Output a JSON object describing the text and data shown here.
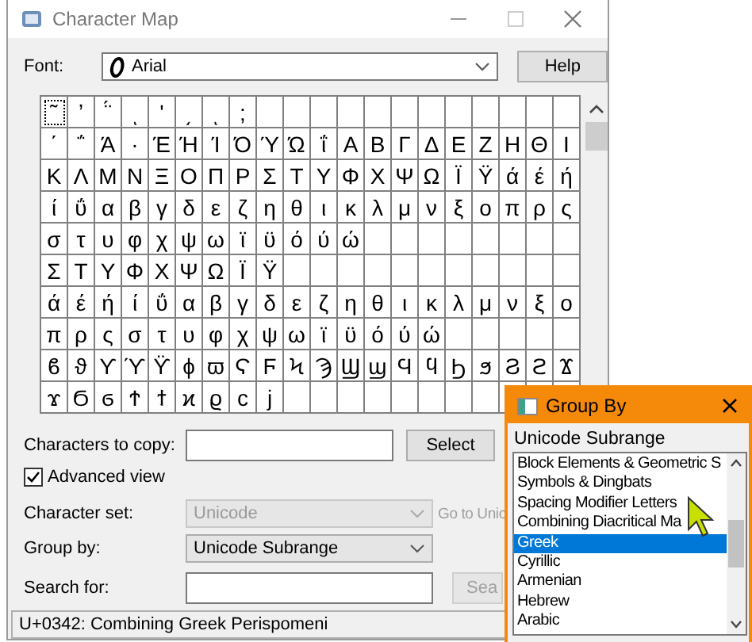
{
  "window": {
    "title": "Character Map"
  },
  "font": {
    "label": "Font:",
    "value": "Arial",
    "button": "Help"
  },
  "grid": {
    "rows": [
      [
        {
          "char": "˜",
          "selected": true
        },
        {
          "char": "̓",
          "selected": false
        },
        {
          "char": "̈́",
          "selected": false
        },
        {
          "char": "ͅ",
          "selected": false
        },
        {
          "char": "ʹ",
          "selected": false
        },
        {
          "char": "͵",
          "selected": false
        },
        {
          "char": "ͺ",
          "selected": false
        },
        {
          "char": ";",
          "selected": false
        }
      ],
      [
        {
          "char": "΄",
          "selected": false
        },
        {
          "char": "΅",
          "selected": false
        },
        {
          "char": "Ά",
          "selected": false
        },
        {
          "char": "·",
          "selected": false
        },
        {
          "char": "Έ",
          "selected": false
        },
        {
          "char": "Ή",
          "selected": false
        },
        {
          "char": "Ί",
          "selected": false
        },
        {
          "char": "Ό",
          "selected": false
        },
        {
          "char": "Ύ",
          "selected": false
        },
        {
          "char": "Ώ",
          "selected": false
        },
        {
          "char": "ΐ",
          "selected": false
        },
        {
          "char": "Α",
          "selected": false
        },
        {
          "char": "Β",
          "selected": false
        },
        {
          "char": "Γ",
          "selected": false
        },
        {
          "char": "Δ",
          "selected": false
        },
        {
          "char": "Ε",
          "selected": false
        },
        {
          "char": "Ζ",
          "selected": false
        },
        {
          "char": "Η",
          "selected": false
        },
        {
          "char": "Θ",
          "selected": false
        },
        {
          "char": "Ι",
          "selected": false
        }
      ],
      [
        {
          "char": "Κ",
          "selected": false
        },
        {
          "char": "Λ",
          "selected": false
        },
        {
          "char": "Μ",
          "selected": false
        },
        {
          "char": "Ν",
          "selected": false
        },
        {
          "char": "Ξ",
          "selected": false
        },
        {
          "char": "Ο",
          "selected": false
        },
        {
          "char": "Π",
          "selected": false
        },
        {
          "char": "Ρ",
          "selected": false
        },
        {
          "char": "Σ",
          "selected": false
        },
        {
          "char": "Τ",
          "selected": false
        },
        {
          "char": "Υ",
          "selected": false
        },
        {
          "char": "Φ",
          "selected": false
        },
        {
          "char": "Χ",
          "selected": false
        },
        {
          "char": "Ψ",
          "selected": false
        },
        {
          "char": "Ω",
          "selected": false
        },
        {
          "char": "Ϊ",
          "selected": false
        },
        {
          "char": "Ϋ",
          "selected": false
        },
        {
          "char": "ά",
          "selected": false
        },
        {
          "char": "έ",
          "selected": false
        },
        {
          "char": "ή",
          "selected": false
        }
      ],
      [
        {
          "char": "ί",
          "selected": false
        },
        {
          "char": "ΰ",
          "selected": false
        },
        {
          "char": "α",
          "selected": false
        },
        {
          "char": "β",
          "selected": false
        },
        {
          "char": "γ",
          "selected": false
        },
        {
          "char": "δ",
          "selected": false
        },
        {
          "char": "ε",
          "selected": false
        },
        {
          "char": "ζ",
          "selected": false
        },
        {
          "char": "η",
          "selected": false
        },
        {
          "char": "θ",
          "selected": false
        },
        {
          "char": "ι",
          "selected": false
        },
        {
          "char": "κ",
          "selected": false
        },
        {
          "char": "λ",
          "selected": false
        },
        {
          "char": "μ",
          "selected": false
        },
        {
          "char": "ν",
          "selected": false
        },
        {
          "char": "ξ",
          "selected": false
        },
        {
          "char": "ο",
          "selected": false
        },
        {
          "char": "π",
          "selected": false
        },
        {
          "char": "ρ",
          "selected": false
        },
        {
          "char": "ς",
          "selected": false
        }
      ],
      [
        {
          "char": "σ",
          "selected": false
        },
        {
          "char": "τ",
          "selected": false
        },
        {
          "char": "υ",
          "selected": false
        },
        {
          "char": "φ",
          "selected": false
        },
        {
          "char": "χ",
          "selected": false
        },
        {
          "char": "ψ",
          "selected": false
        },
        {
          "char": "ω",
          "selected": false
        },
        {
          "char": "ϊ",
          "selected": false
        },
        {
          "char": "ϋ",
          "selected": false
        },
        {
          "char": "ό",
          "selected": false
        },
        {
          "char": "ύ",
          "selected": false
        },
        {
          "char": "ώ",
          "selected": false
        }
      ],
      [
        {
          "char": "Σ",
          "selected": false
        },
        {
          "char": "Τ",
          "selected": false
        },
        {
          "char": "Υ",
          "selected": false
        },
        {
          "char": "Φ",
          "selected": false
        },
        {
          "char": "Χ",
          "selected": false
        },
        {
          "char": "Ψ",
          "selected": false
        },
        {
          "char": "Ω",
          "selected": false
        },
        {
          "char": "Ϊ",
          "selected": false
        },
        {
          "char": "Ϋ",
          "selected": false
        }
      ],
      [
        {
          "char": "ά",
          "selected": false
        },
        {
          "char": "έ",
          "selected": false
        },
        {
          "char": "ή",
          "selected": false
        },
        {
          "char": "ί",
          "selected": false
        },
        {
          "char": "ΰ",
          "selected": false
        },
        {
          "char": "α",
          "selected": false
        },
        {
          "char": "β",
          "selected": false
        },
        {
          "char": "γ",
          "selected": false
        },
        {
          "char": "δ",
          "selected": false
        },
        {
          "char": "ε",
          "selected": false
        },
        {
          "char": "ζ",
          "selected": false
        },
        {
          "char": "η",
          "selected": false
        },
        {
          "char": "θ",
          "selected": false
        },
        {
          "char": "ι",
          "selected": false
        },
        {
          "char": "κ",
          "selected": false
        },
        {
          "char": "λ",
          "selected": false
        },
        {
          "char": "μ",
          "selected": false
        },
        {
          "char": "ν",
          "selected": false
        },
        {
          "char": "ξ",
          "selected": false
        },
        {
          "char": "ο",
          "selected": false
        }
      ],
      [
        {
          "char": "π",
          "selected": false
        },
        {
          "char": "ρ",
          "selected": false
        },
        {
          "char": "ς",
          "selected": false
        },
        {
          "char": "σ",
          "selected": false
        },
        {
          "char": "τ",
          "selected": false
        },
        {
          "char": "υ",
          "selected": false
        },
        {
          "char": "φ",
          "selected": false
        },
        {
          "char": "χ",
          "selected": false
        },
        {
          "char": "ψ",
          "selected": false
        },
        {
          "char": "ω",
          "selected": false
        },
        {
          "char": "ϊ",
          "selected": false
        },
        {
          "char": "ϋ",
          "selected": false
        },
        {
          "char": "ό",
          "selected": false
        },
        {
          "char": "ύ",
          "selected": false
        },
        {
          "char": "ώ",
          "selected": false
        }
      ],
      [
        {
          "char": "ϐ",
          "selected": false
        },
        {
          "char": "ϑ",
          "selected": false
        },
        {
          "char": "ϒ",
          "selected": false
        },
        {
          "char": "ϓ",
          "selected": false
        },
        {
          "char": "ϔ",
          "selected": false
        },
        {
          "char": "ϕ",
          "selected": false
        },
        {
          "char": "ϖ",
          "selected": false
        },
        {
          "char": "Ϛ",
          "selected": false
        },
        {
          "char": "Ϝ",
          "selected": false
        },
        {
          "char": "Ϟ",
          "selected": false
        },
        {
          "char": "Ϡ",
          "selected": false
        },
        {
          "char": "Ϣ",
          "selected": false
        },
        {
          "char": "ϣ",
          "selected": false
        },
        {
          "char": "Ϥ",
          "selected": false
        },
        {
          "char": "ϥ",
          "selected": false
        },
        {
          "char": "Ϧ",
          "selected": false
        },
        {
          "char": "ϧ",
          "selected": false
        },
        {
          "char": "Ϩ",
          "selected": false
        },
        {
          "char": "ϩ",
          "selected": false
        },
        {
          "char": "Ϫ",
          "selected": false
        }
      ],
      [
        {
          "char": "ϫ",
          "selected": false
        },
        {
          "char": "Ϭ",
          "selected": false
        },
        {
          "char": "ϭ",
          "selected": false
        },
        {
          "char": "Ϯ",
          "selected": false
        },
        {
          "char": "ϯ",
          "selected": false
        },
        {
          "char": "ϰ",
          "selected": false
        },
        {
          "char": "ϱ",
          "selected": false
        },
        {
          "char": "ϲ",
          "selected": false
        },
        {
          "char": "ϳ",
          "selected": false
        }
      ]
    ]
  },
  "copy": {
    "label": "Characters to copy:",
    "button": "Select"
  },
  "advanced_view": {
    "label": "Advanced view",
    "checked": true
  },
  "character_set": {
    "label": "Character set:",
    "value": "Unicode",
    "disabled": true,
    "link": "Go to Unic"
  },
  "group_by": {
    "label": "Group by:",
    "value": "Unicode Subrange",
    "disabled": false
  },
  "search": {
    "label": "Search for:",
    "button": "Sea",
    "button_disabled": true
  },
  "status_bar": "U+0342: Combining Greek Perispomeni",
  "group_by_dialog": {
    "title": "Group By",
    "label": "Unicode Subrange",
    "items": [
      {
        "label": "Block Elements & Geometric S",
        "selected": false
      },
      {
        "label": "Symbols & Dingbats",
        "selected": false
      },
      {
        "label": "Spacing Modifier Letters",
        "selected": false
      },
      {
        "label": "Combining Diacritical Ma",
        "selected": false
      },
      {
        "label": "Greek",
        "selected": true
      },
      {
        "label": "Cyrillic",
        "selected": false
      },
      {
        "label": "Armenian",
        "selected": false
      },
      {
        "label": "Hebrew",
        "selected": false
      },
      {
        "label": "Arabic",
        "selected": false
      }
    ]
  }
}
